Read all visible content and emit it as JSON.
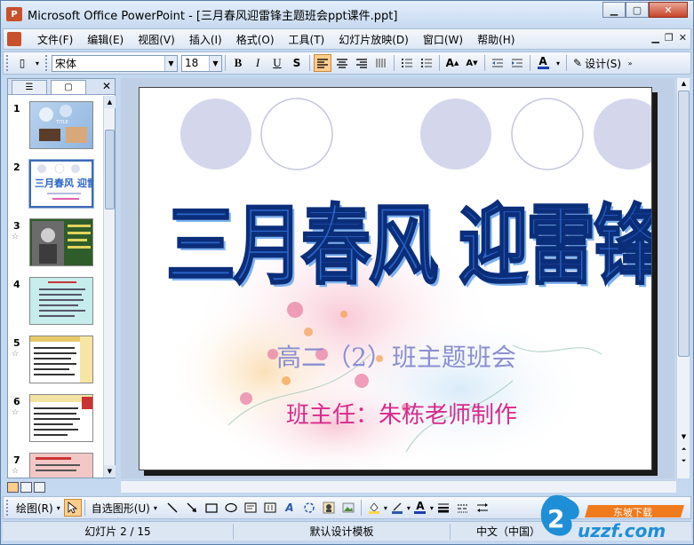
{
  "window": {
    "title": "Microsoft Office PowerPoint - [三月春风迎雷锋主题班会ppt课件.ppt]",
    "app_icon_text": "P"
  },
  "menu": {
    "items": [
      "文件(F)",
      "编辑(E)",
      "视图(V)",
      "插入(I)",
      "格式(O)",
      "工具(T)",
      "幻灯片放映(D)",
      "窗口(W)",
      "帮助(H)"
    ]
  },
  "toolbar": {
    "font_name": "宋体",
    "font_size": "18",
    "design_label": "设计(S)"
  },
  "thumbnails": [
    {
      "number": "1",
      "has_animation": false,
      "selected": false
    },
    {
      "number": "2",
      "has_animation": false,
      "selected": true
    },
    {
      "number": "3",
      "has_animation": true,
      "selected": false
    },
    {
      "number": "4",
      "has_animation": false,
      "selected": false
    },
    {
      "number": "5",
      "has_animation": true,
      "selected": false
    },
    {
      "number": "6",
      "has_animation": true,
      "selected": false
    },
    {
      "number": "7",
      "has_animation": true,
      "selected": false
    }
  ],
  "slide": {
    "title": "三月春风 迎雷锋",
    "subtitle": "高二（2）班主题班会",
    "author": "班主任：朱栋老师制作"
  },
  "drawing_toolbar": {
    "draw_label": "绘图(R)",
    "autoshapes_label": "自选图形(U)"
  },
  "status": {
    "slide_info": "幻灯片 2 / 15",
    "template": "默认设计模板",
    "language": "中文（中国）"
  },
  "watermark": {
    "brand_top": "东坡下载",
    "brand_main": "uzzf.com"
  },
  "colors": {
    "title_blue": "#2b64c8",
    "subtitle_purple": "#8a8fd2",
    "author_pink": "#d92a8d",
    "frame": "#c4d8ef"
  }
}
